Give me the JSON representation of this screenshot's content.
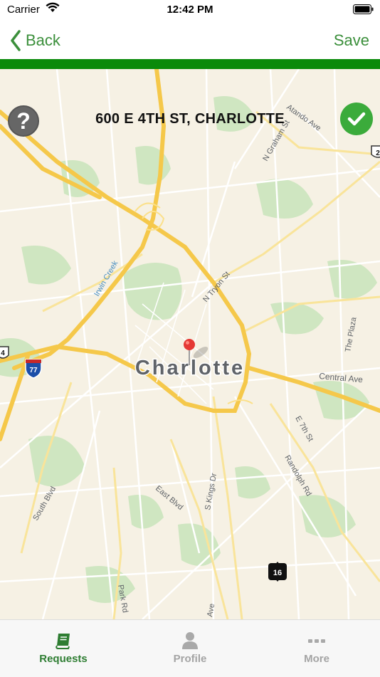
{
  "status_bar": {
    "carrier": "Carrier",
    "time": "12:42 PM"
  },
  "nav": {
    "back_label": "Back",
    "save_label": "Save"
  },
  "map": {
    "address": "600 E 4TH ST, CHARLOTTE",
    "help_symbol": "?",
    "city_label": "Charlotte",
    "street_labels": [
      "Atando Ave",
      "N Graham St",
      "N Tryon St",
      "Irwin Creek",
      "The Plaza",
      "Central Ave",
      "E 7th St",
      "Randolph Rd",
      "S Kings Dr",
      "East Blvd",
      "South Blvd",
      "Park Rd",
      "Ave"
    ],
    "route_shields": [
      "77",
      "16",
      "4",
      "2"
    ]
  },
  "tabs": [
    {
      "label": "Requests",
      "icon": "book-icon",
      "active": true
    },
    {
      "label": "Profile",
      "icon": "person-icon",
      "active": false
    },
    {
      "label": "More",
      "icon": "ellipsis-icon",
      "active": false
    }
  ],
  "colors": {
    "accent": "#3b8f3b",
    "header_bar": "#0a8a0a",
    "confirm": "#3bab3b",
    "map_bg": "#f6f1e4",
    "highway": "#f5c84a",
    "pin": "#e53935"
  }
}
